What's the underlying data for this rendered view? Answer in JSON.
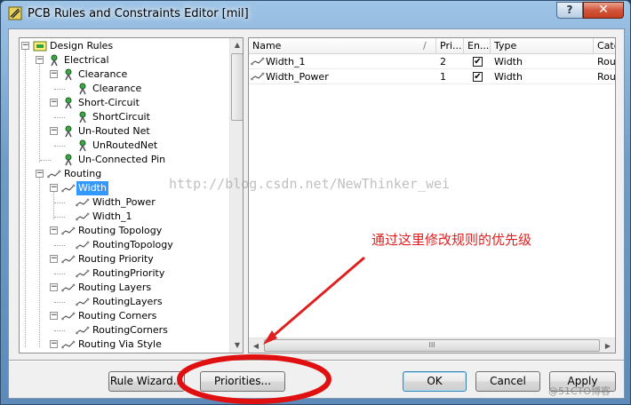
{
  "window": {
    "title": "PCB Rules and Constraints Editor [mil]",
    "help_label": "?",
    "close_label": "✕"
  },
  "tree": {
    "nodes": [
      {
        "label": "Design Rules",
        "expander": "−"
      },
      {
        "label": "Electrical",
        "expander": "−"
      },
      {
        "label": "Clearance",
        "expander": "−"
      },
      {
        "label": "Clearance"
      },
      {
        "label": "Short-Circuit",
        "expander": "−"
      },
      {
        "label": "ShortCircuit"
      },
      {
        "label": "Un-Routed Net",
        "expander": "−"
      },
      {
        "label": "UnRoutedNet"
      },
      {
        "label": "Un-Connected Pin"
      },
      {
        "label": "Routing",
        "expander": "−"
      },
      {
        "label": "Width",
        "expander": "−"
      },
      {
        "label": "Width_Power"
      },
      {
        "label": "Width_1"
      },
      {
        "label": "Routing Topology",
        "expander": "−"
      },
      {
        "label": "RoutingTopology"
      },
      {
        "label": "Routing Priority",
        "expander": "−"
      },
      {
        "label": "RoutingPriority"
      },
      {
        "label": "Routing Layers",
        "expander": "−"
      },
      {
        "label": "RoutingLayers"
      },
      {
        "label": "Routing Corners",
        "expander": "−"
      },
      {
        "label": "RoutingCorners"
      },
      {
        "label": "Routing Via Style",
        "expander": "−"
      }
    ],
    "selected_label": "Width"
  },
  "grid": {
    "columns": [
      "Name",
      "/",
      "Pri...",
      "En...",
      "Type",
      "Cate"
    ],
    "rows": [
      {
        "name": "Width_1",
        "priority": "2",
        "enabled": "✔",
        "type": "Width",
        "category": "Rout"
      },
      {
        "name": "Width_Power",
        "priority": "1",
        "enabled": "✔",
        "type": "Width",
        "category": "Rout"
      }
    ],
    "hscroll_grip": "III"
  },
  "buttons": {
    "rule_wizard": "Rule Wizard...",
    "priorities": "Priorities...",
    "ok": "OK",
    "cancel": "Cancel",
    "apply": "Apply"
  },
  "overlays": {
    "watermark": "http://blog.csdn.net/NewThinker_wei",
    "annotation": "通过这里修改规则的优先级",
    "corner_mark": "@51CTO博客"
  },
  "colors": {
    "selection": "#3399ff",
    "annotation_red": "#e02020"
  }
}
